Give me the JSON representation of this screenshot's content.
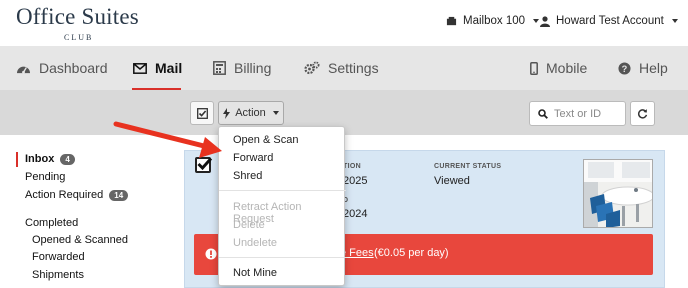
{
  "brand": {
    "name": "Office Suites",
    "sub": "CLUB"
  },
  "account": {
    "mailbox_label": "Mailbox 100",
    "user_label": "Howard Test Account"
  },
  "nav": {
    "dashboard": "Dashboard",
    "mail": "Mail",
    "billing": "Billing",
    "settings": "Settings",
    "mobile": "Mobile",
    "help": "Help"
  },
  "toolbar": {
    "action_label": "Action",
    "search_placeholder": "Text or ID"
  },
  "sidebar": {
    "inbox": "Inbox",
    "inbox_count": "4",
    "pending": "Pending",
    "action_required": "Action Required",
    "action_required_count": "14",
    "completed": "Completed",
    "opened_scanned": "Opened & Scanned",
    "forwarded": "Forwarded",
    "shipments": "Shipments"
  },
  "mail_item": {
    "field1_label_partial": "TION",
    "field1_value_partial": "2025",
    "field2_label_partial": "D",
    "field2_value_partial": "2024",
    "status_label": "CURRENT STATUS",
    "status_value": "Viewed"
  },
  "alert": {
    "link_partial": "e Fees",
    "rate_text": "(€0.05 per day)"
  },
  "menu": {
    "open_scan": "Open & Scan",
    "forward": "Forward",
    "shred": "Shred",
    "retract": "Retract Action Request",
    "delete": "Delete",
    "undelete": "Undelete",
    "not_mine": "Not Mine"
  },
  "colors": {
    "accent": "#d9302a",
    "alert_bg": "#e8473d",
    "card_bg": "#d8e7f4",
    "nav_bg": "#e6e6e6",
    "toolbar_bg": "#d9d9d9"
  }
}
